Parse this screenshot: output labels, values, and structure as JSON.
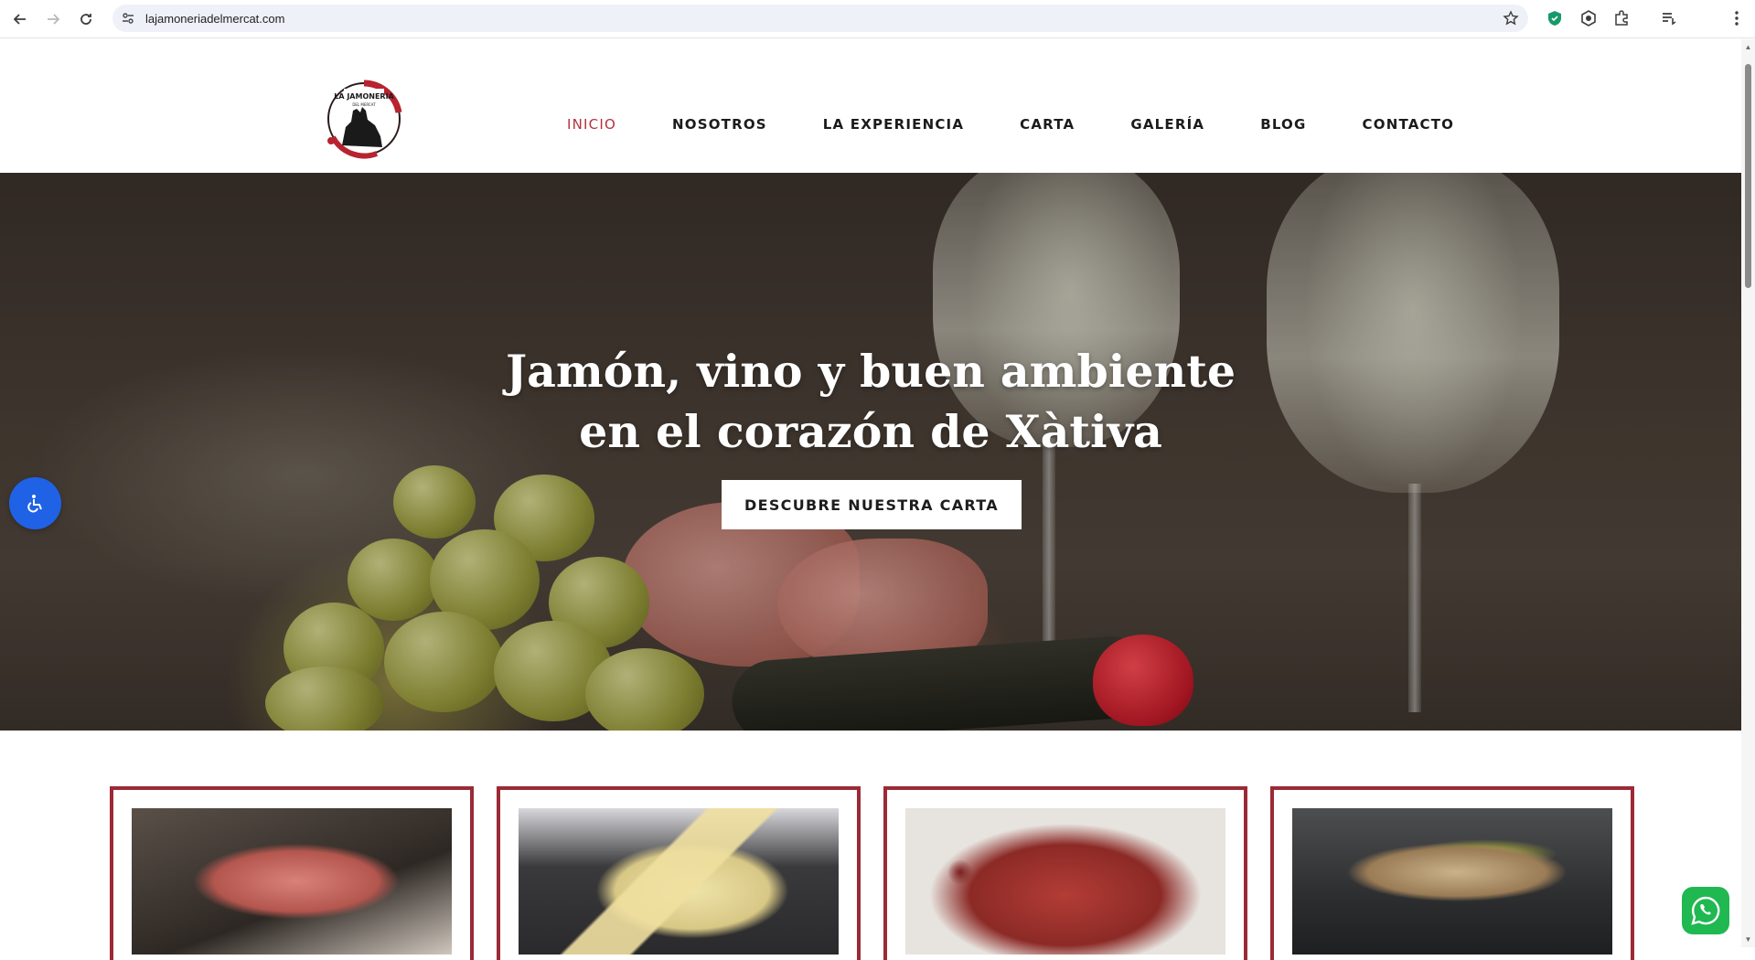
{
  "browser": {
    "url": "lajamoneriadelmercat.com",
    "icons": [
      "back-icon",
      "forward-icon",
      "reload-icon",
      "site-info-icon",
      "bookmark-star-icon",
      "shield-extension-icon",
      "hexagon-extension-icon",
      "puzzle-extensions-icon",
      "reading-list-icon",
      "more-menu-icon"
    ]
  },
  "header": {
    "logo_text": "LA JAMONERIA DEL MERCAT",
    "nav": [
      {
        "label": "INICIO",
        "active": true
      },
      {
        "label": "NOSOTROS",
        "active": false
      },
      {
        "label": "LA EXPERIENCIA",
        "active": false
      },
      {
        "label": "CARTA",
        "active": false
      },
      {
        "label": "GALERÍA",
        "active": false
      },
      {
        "label": "BLOG",
        "active": false
      },
      {
        "label": "CONTACTO",
        "active": false
      }
    ]
  },
  "hero": {
    "title_line1": "Jamón, vino y buen ambiente",
    "title_line2": "en el corazón de Xàtiva",
    "cta_label": "DESCUBRE NUESTRA CARTA"
  },
  "colors": {
    "accent": "#b2323e",
    "card_border": "#9b2a36",
    "a11y_button": "#1f62e6",
    "whatsapp": "#1fb851"
  },
  "cards": [
    {
      "image": "ham-toast-photo"
    },
    {
      "image": "cheese-board-photo"
    },
    {
      "image": "cured-sausage-platter-photo"
    },
    {
      "image": "tuna-pepper-toast-photo"
    }
  ]
}
